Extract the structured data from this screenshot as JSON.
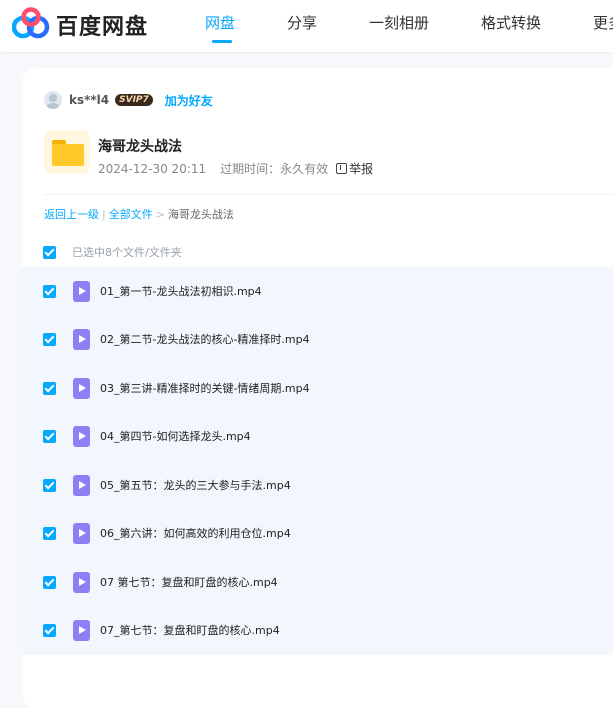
{
  "header": {
    "logo_text": "百度网盘",
    "nav": [
      "网盘",
      "分享",
      "一刻相册",
      "格式转换",
      "更多"
    ],
    "active_nav": "网盘",
    "brand_color": "#06a7ff"
  },
  "owner": {
    "username": "ks**l4",
    "badge": "SVIP7",
    "add_friend": "加为好友"
  },
  "share": {
    "title": "海哥龙头战法",
    "date": "2024-12-30 20:11",
    "expire_label": "过期时间：永久有效",
    "report": "举报",
    "icon": "folder-icon"
  },
  "breadcrumb": {
    "back": "返回上一级",
    "sep": "|",
    "all_files": "全部文件",
    "arrow": ">",
    "current": "海哥龙头战法"
  },
  "selection": {
    "text": "已选中8个文件/文件夹",
    "checked": true
  },
  "files": [
    {
      "name": "01_第一节-龙头战法初相识.mp4",
      "checked": true
    },
    {
      "name": "02_第二节-龙头战法的核心-精准择时.mp4",
      "checked": true
    },
    {
      "name": "03_第三讲-精准择时的关键-情绪周期.mp4",
      "checked": true
    },
    {
      "name": "04_第四节-如何选择龙头.mp4",
      "checked": true
    },
    {
      "name": "05_第五节：龙头的三大参与手法.mp4",
      "checked": true
    },
    {
      "name": "06_第六讲：如何高效的利用仓位.mp4",
      "checked": true
    },
    {
      "name": "07 第七节：复盘和盯盘的核心.mp4",
      "checked": true
    },
    {
      "name": "07_第七节：复盘和盯盘的核心.mp4",
      "checked": true
    }
  ]
}
